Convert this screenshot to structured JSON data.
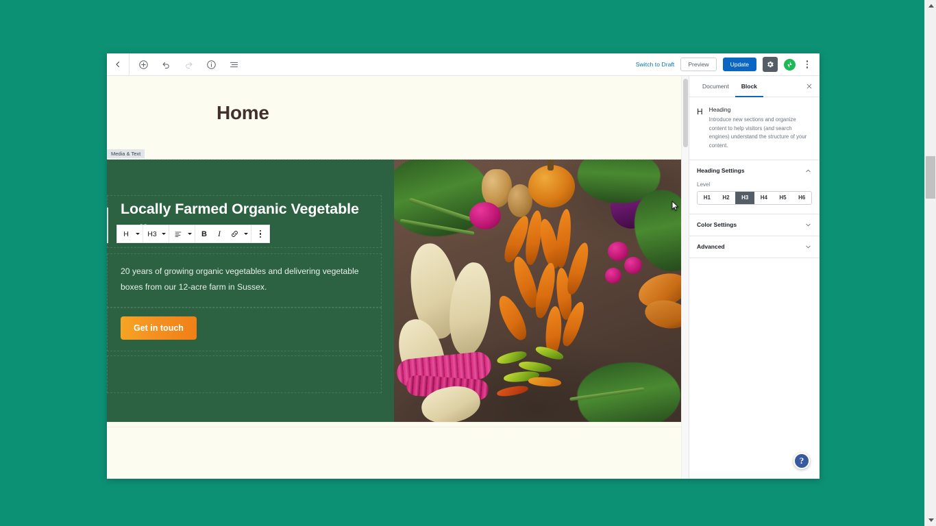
{
  "top_bar": {
    "icons": [
      {
        "name": "back-arrow-icon",
        "label": "Back"
      },
      {
        "name": "add-block-icon",
        "label": "Add block"
      },
      {
        "name": "undo-icon",
        "label": "Undo"
      },
      {
        "name": "redo-icon",
        "label": "Redo"
      },
      {
        "name": "info-icon",
        "label": "Content structure"
      },
      {
        "name": "list-view-icon",
        "label": "Block navigation"
      }
    ],
    "switch_to_draft": "Switch to Draft",
    "preview_label": "Preview",
    "update_label": "Update",
    "settings_icon": "gear-icon",
    "jetpack_icon": "jetpack-bolt-icon",
    "more_menu_icon": "kebab-menu-icon"
  },
  "canvas": {
    "page_title": "Home",
    "block_label": "Media & Text",
    "heading": "Locally Farmed Organic Vegetable Delivery",
    "paragraph": "20 years of growing organic vegetables and delivering vegetable boxes from our 12-acre farm in Sussex.",
    "cta_button": "Get in touch",
    "media_alt": "Overhead photo of freshly harvested organic vegetables on soil"
  },
  "block_toolbar": {
    "block_type": "H",
    "heading_level": "H3",
    "align_icon": "align-left-icon",
    "bold": "B",
    "italic": "I",
    "link_icon": "link-icon",
    "more_icon": "kebab-menu-icon"
  },
  "sidebar": {
    "tabs": [
      {
        "label": "Document",
        "active": false
      },
      {
        "label": "Block",
        "active": true
      }
    ],
    "close_icon": "close-icon",
    "block_card": {
      "icon": "H",
      "title": "Heading",
      "description": "Introduce new sections and organize content to help visitors (and search engines) understand the structure of your content."
    },
    "panels": [
      {
        "title": "Heading Settings",
        "expanded": true
      },
      {
        "title": "Color Settings",
        "expanded": false
      },
      {
        "title": "Advanced",
        "expanded": false
      }
    ],
    "heading_settings": {
      "field_label": "Level",
      "levels": [
        "H1",
        "H2",
        "H3",
        "H4",
        "H5",
        "H6"
      ],
      "selected_level": "H3"
    },
    "help_label": "?"
  },
  "colors": {
    "desktop_background": "#0d9175",
    "block_green": "#2c6242",
    "canvas_cream": "#fcfcf0",
    "title_brown": "#41302c",
    "update_blue": "#0b66c3",
    "cta_orange": "#f59222",
    "jetpack_green": "#1db954",
    "help_blue": "#3858a0"
  }
}
